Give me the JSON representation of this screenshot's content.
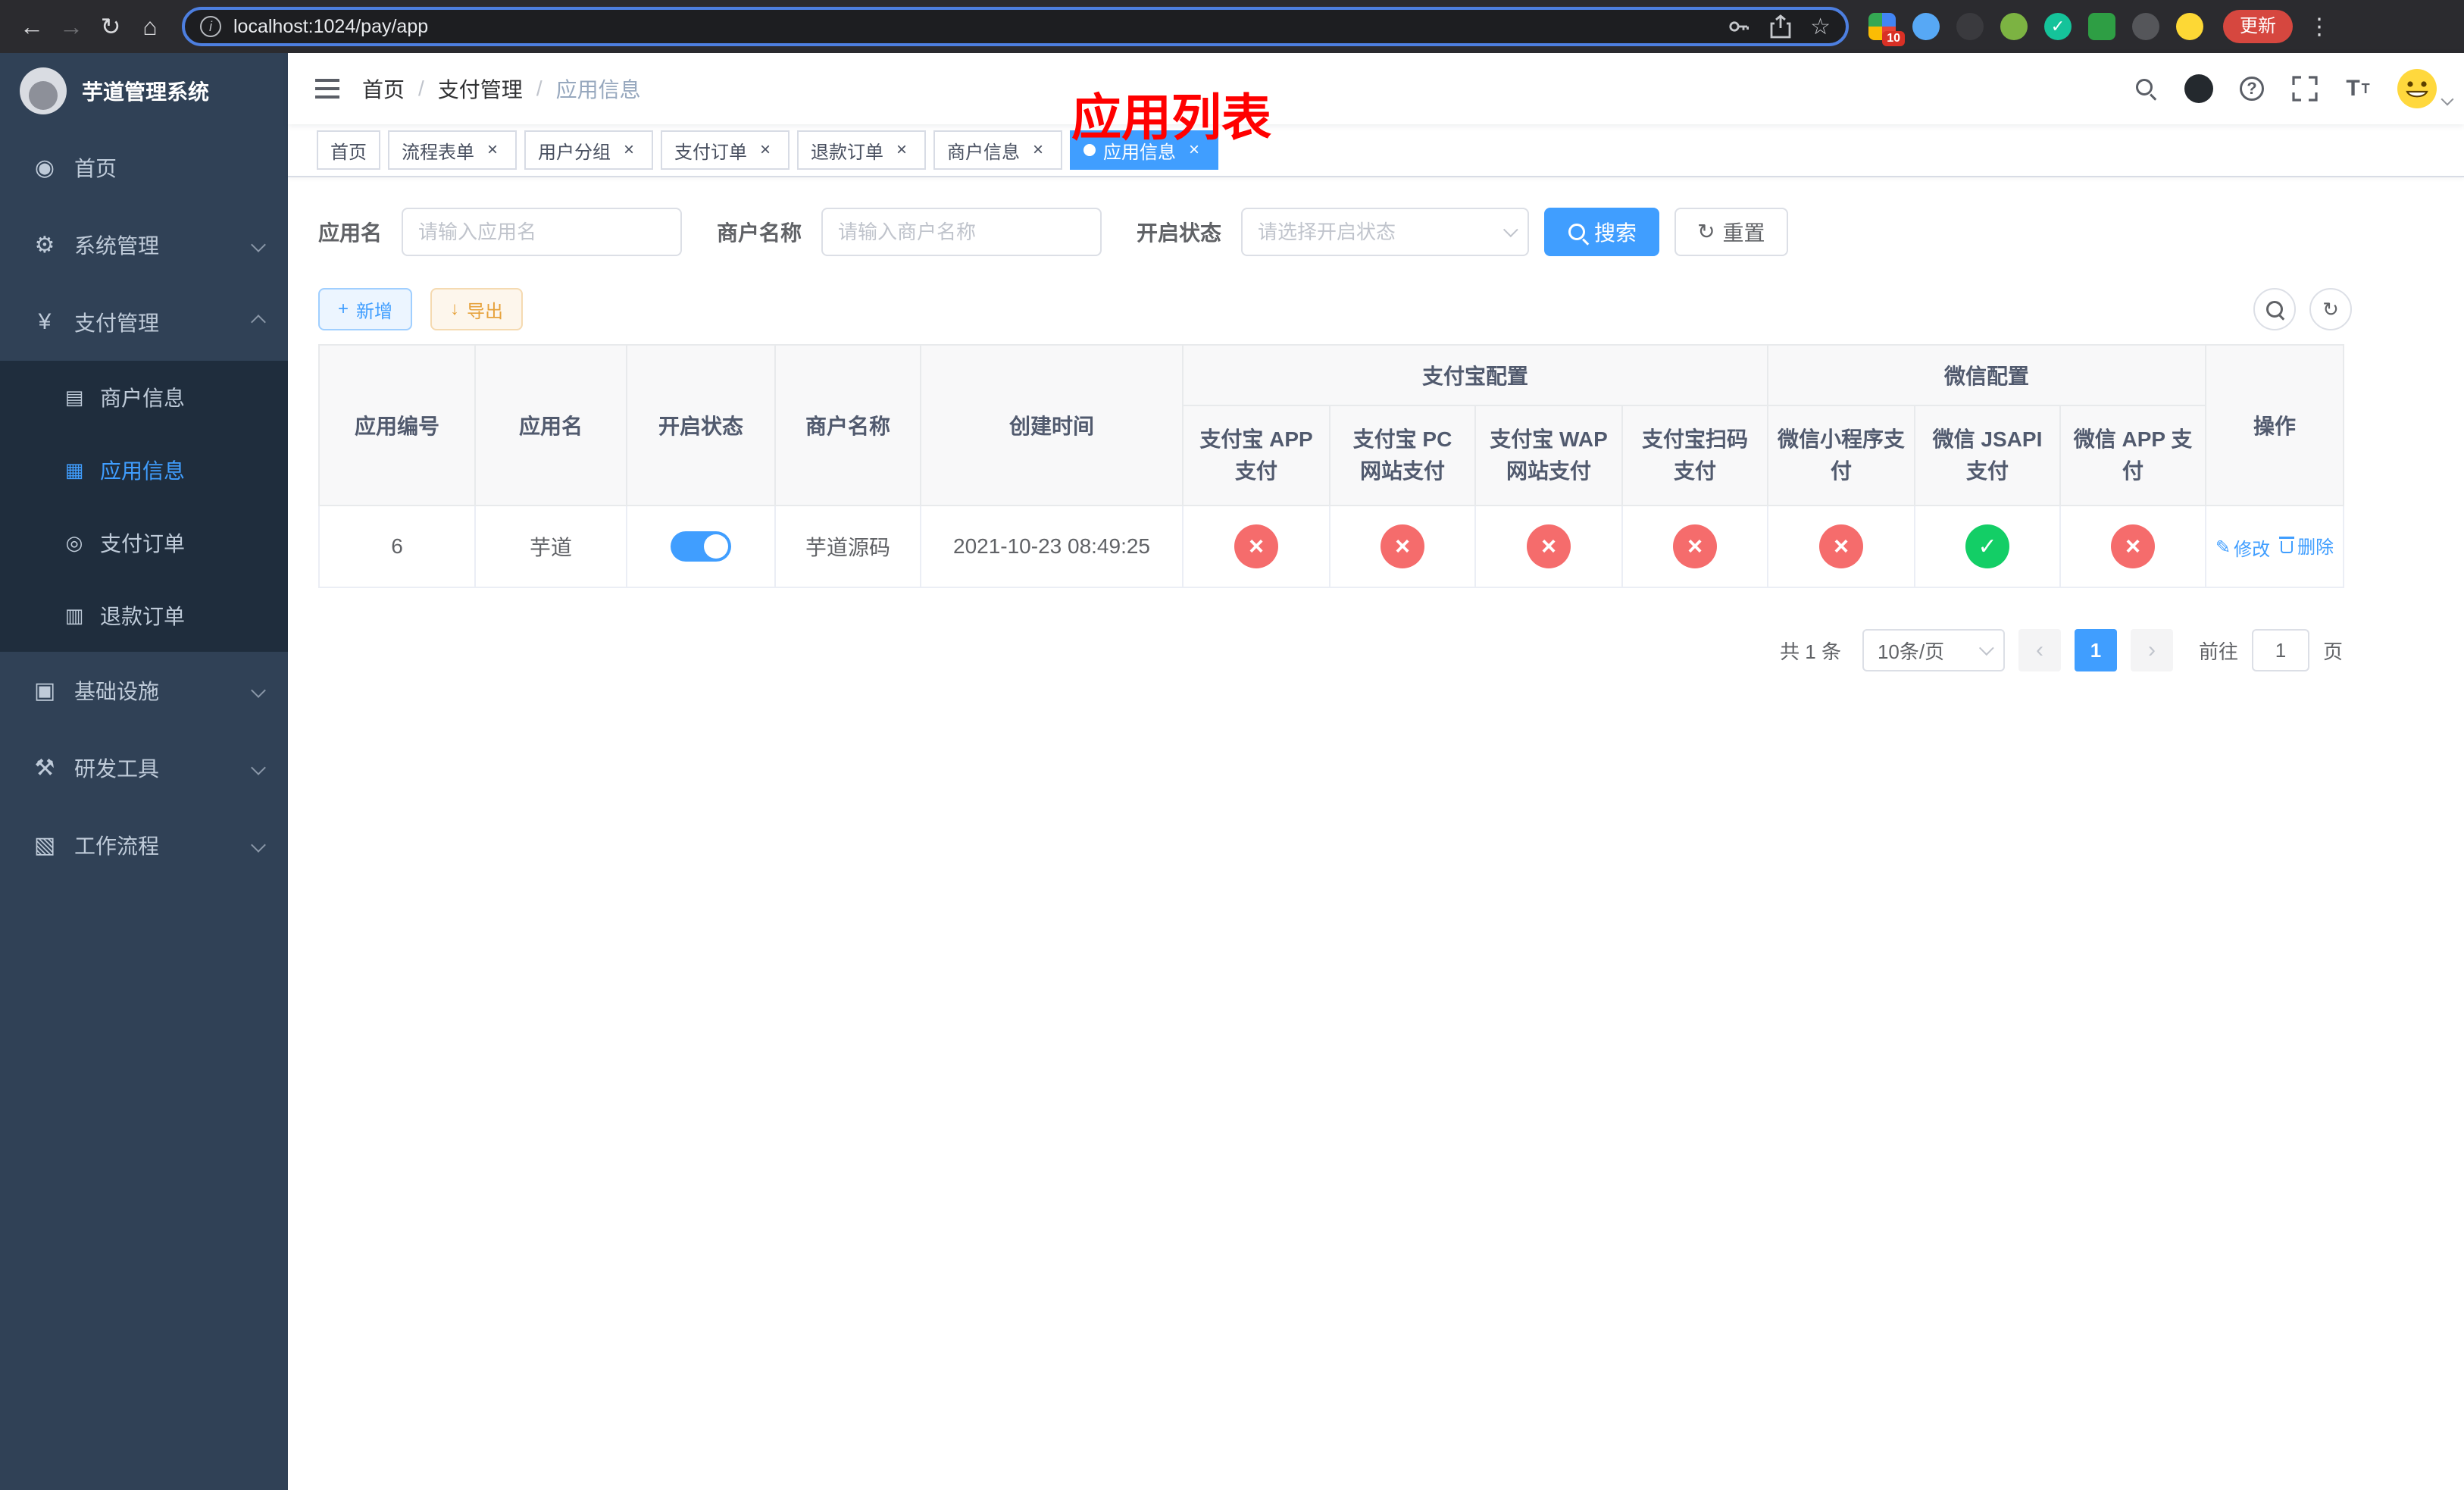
{
  "browser": {
    "url": "localhost:1024/pay/app",
    "update_label": "更新",
    "extension_badge": "10"
  },
  "icons": {
    "back": "←",
    "forward": "→",
    "reload": "↻",
    "home": "⌂",
    "info": "i",
    "star": "☆",
    "menu": "⋮",
    "dashboard": "◉",
    "gear": "⚙",
    "yen": "¥",
    "merchant": "▤",
    "app": "▦",
    "order": "◎",
    "refund": "▥",
    "infra": "▣",
    "tools": "⚒",
    "workflow": "▧",
    "close": "×",
    "check": "✓",
    "plus": "+",
    "download": "↓",
    "refresh": "↻",
    "edit": "✎",
    "question": "?",
    "font_size": "T",
    "prev": "‹",
    "next": "›"
  },
  "sidebar": {
    "title": "芋道管理系统",
    "items": [
      {
        "label": "首页"
      },
      {
        "label": "系统管理"
      },
      {
        "label": "支付管理"
      },
      {
        "label": "基础设施"
      },
      {
        "label": "研发工具"
      },
      {
        "label": "工作流程"
      }
    ],
    "payment_children": [
      {
        "label": "商户信息"
      },
      {
        "label": "应用信息"
      },
      {
        "label": "支付订单"
      },
      {
        "label": "退款订单"
      }
    ]
  },
  "header": {
    "separator": "/",
    "breadcrumb": [
      {
        "label": "首页"
      },
      {
        "label": "支付管理"
      },
      {
        "label": "应用信息"
      }
    ],
    "annotation": "应用列表"
  },
  "tabs": [
    {
      "label": "首页"
    },
    {
      "label": "流程表单"
    },
    {
      "label": "用户分组"
    },
    {
      "label": "支付订单"
    },
    {
      "label": "退款订单"
    },
    {
      "label": "商户信息"
    },
    {
      "label": "应用信息"
    }
  ],
  "filters": {
    "app_name_label": "应用名",
    "app_name_placeholder": "请输入应用名",
    "merchant_label": "商户名称",
    "merchant_placeholder": "请输入商户名称",
    "status_label": "开启状态",
    "status_placeholder": "请选择开启状态",
    "search_label": "搜索",
    "reset_label": "重置"
  },
  "toolbar": {
    "add_label": "新增",
    "export_label": "导出"
  },
  "table": {
    "headers": {
      "app_id": "应用编号",
      "app_name": "应用名",
      "status": "开启状态",
      "merchant": "商户名称",
      "created": "创建时间",
      "alipay_group": "支付宝配置",
      "wechat_group": "微信配置",
      "alipay_app": "支付宝 APP 支付",
      "alipay_pc": "支付宝 PC 网站支付",
      "alipay_wap": "支付宝 WAP 网站支付",
      "alipay_qr": "支付宝扫码支付",
      "wechat_mini": "微信小程序支付",
      "wechat_jsapi": "微信 JSAPI 支付",
      "wechat_app": "微信 APP 支付",
      "actions": "操作"
    },
    "rows": [
      {
        "app_id": "6",
        "app_name": "芋道",
        "status": "on",
        "merchant": "芋道源码",
        "created": "2021-10-23 08:49:25",
        "alipay_app": "no",
        "alipay_pc": "no",
        "alipay_wap": "no",
        "alipay_qr": "no",
        "wechat_mini": "no",
        "wechat_jsapi": "yes",
        "wechat_app": "no",
        "edit_label": "修改",
        "delete_label": "删除"
      }
    ]
  },
  "pagination": {
    "total": "共 1 条",
    "page_size": "10条/页",
    "page": "1",
    "goto_label": "前往",
    "goto_value": "1",
    "goto_unit": "页"
  },
  "colors": {
    "accent": "#409eff",
    "danger": "#f56c6c",
    "success": "#13ce66",
    "warning": "#e6a23c",
    "sidebar_bg": "#304156",
    "annotation_red": "#ff0000"
  }
}
